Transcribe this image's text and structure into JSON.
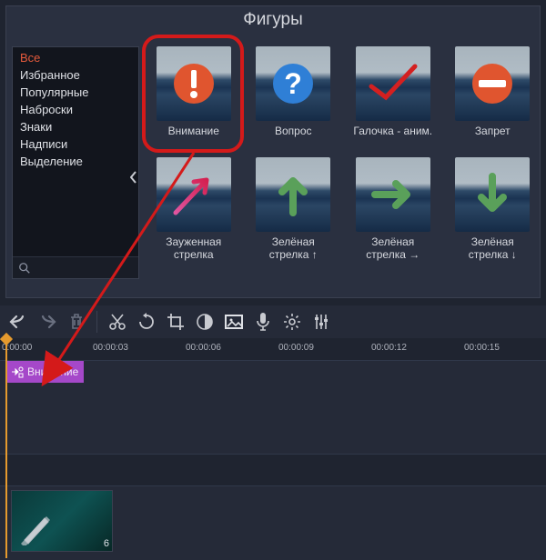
{
  "panel": {
    "title": "Фигуры"
  },
  "sidebar": {
    "items": [
      {
        "label": "Все",
        "active": true
      },
      {
        "label": "Избранное",
        "active": false
      },
      {
        "label": "Популярные",
        "active": false
      },
      {
        "label": "Наброски",
        "active": false
      },
      {
        "label": "Знаки",
        "active": false
      },
      {
        "label": "Надписи",
        "active": false
      },
      {
        "label": "Выделение",
        "active": false
      }
    ]
  },
  "shapes": {
    "row1": [
      {
        "label": "Внимание",
        "icon": "attention"
      },
      {
        "label": "Вопрос",
        "icon": "question"
      },
      {
        "label": "Галочка - аним.",
        "icon": "check"
      },
      {
        "label": "Запрет",
        "icon": "forbid"
      }
    ],
    "row2": [
      {
        "label": "Зауженная стрелка",
        "icon": "arrow-pink"
      },
      {
        "label": "Зелёная стрелка ↑",
        "icon": "arrow-up"
      },
      {
        "label": "Зелёная стрелка →",
        "icon": "arrow-right"
      },
      {
        "label": "Зелёная стрелка ↓",
        "icon": "arrow-down"
      }
    ]
  },
  "timeline": {
    "ticks": [
      "0:00:00",
      "00:00:03",
      "00:00:06",
      "00:00:09",
      "00:00:12",
      "00:00:15"
    ],
    "title_clip": "Внимание",
    "video_clip_label": "6"
  }
}
